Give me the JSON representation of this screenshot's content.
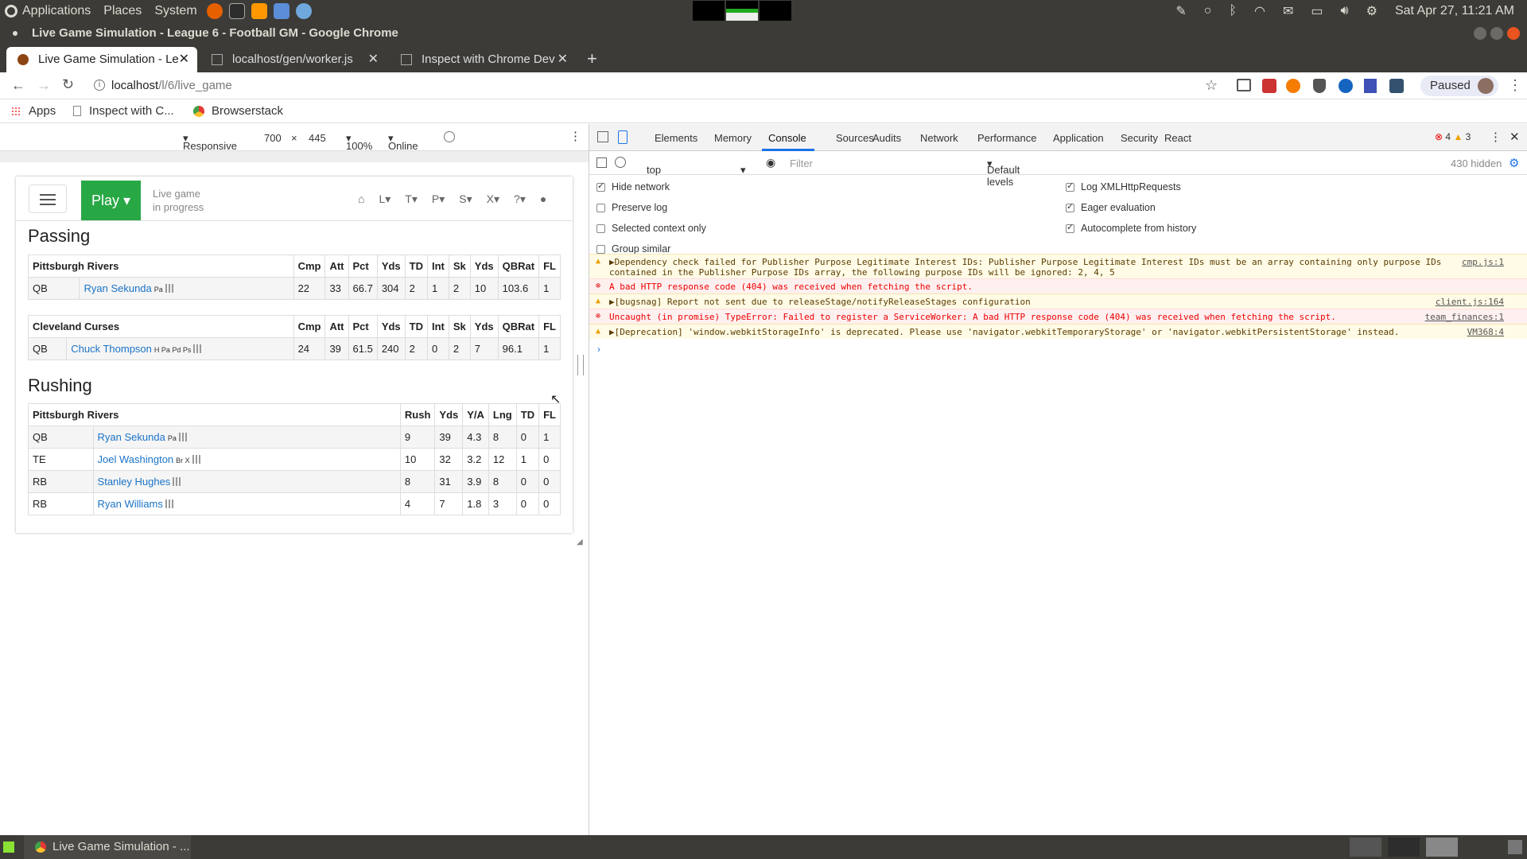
{
  "system_bar": {
    "menus": [
      "Applications",
      "Places",
      "System"
    ],
    "datetime": "Sat Apr 27, 11:21 AM"
  },
  "window": {
    "title": "Live Game Simulation - League 6 - Football GM - Google Chrome"
  },
  "tabs": [
    {
      "label": "Live Game Simulation - Le",
      "active": true
    },
    {
      "label": "localhost/gen/worker.js",
      "active": false
    },
    {
      "label": "Inspect with Chrome Dev",
      "active": false
    }
  ],
  "omnibox": {
    "host": "localhost",
    "path": "/l/6/live_game",
    "profile_status": "Paused"
  },
  "bookmarks": [
    "Apps",
    "Inspect with C...",
    "Browserstack"
  ],
  "device_toolbar": {
    "mode": "Responsive",
    "width": "700",
    "x": "×",
    "height": "445",
    "zoom": "100%",
    "network": "Online"
  },
  "page": {
    "play_button": "Play",
    "status_line1": "Live game",
    "status_line2": "in progress",
    "nav_letters": [
      "L",
      "T",
      "P",
      "S",
      "X",
      "?"
    ],
    "passing": {
      "title": "Passing",
      "tables": [
        {
          "team": "Pittsburgh Rivers",
          "cols": [
            "Cmp",
            "Att",
            "Pct",
            "Yds",
            "TD",
            "Int",
            "Sk",
            "Yds",
            "QBRat",
            "FL"
          ],
          "rows": [
            {
              "pos": "QB",
              "name": "Ryan Sekunda",
              "skills": "Pa",
              "vals": [
                "22",
                "33",
                "66.7",
                "304",
                "2",
                "1",
                "2",
                "10",
                "103.6",
                "1"
              ]
            }
          ]
        },
        {
          "team": "Cleveland Curses",
          "cols": [
            "Cmp",
            "Att",
            "Pct",
            "Yds",
            "TD",
            "Int",
            "Sk",
            "Yds",
            "QBRat",
            "FL"
          ],
          "rows": [
            {
              "pos": "QB",
              "name": "Chuck Thompson",
              "skills": "H Pa Pd Ps",
              "vals": [
                "24",
                "39",
                "61.5",
                "240",
                "2",
                "0",
                "2",
                "7",
                "96.1",
                "1"
              ]
            }
          ]
        }
      ]
    },
    "rushing": {
      "title": "Rushing",
      "team": "Pittsburgh Rivers",
      "cols": [
        "Rush",
        "Yds",
        "Y/A",
        "Lng",
        "TD",
        "FL"
      ],
      "rows": [
        {
          "pos": "QB",
          "name": "Ryan Sekunda",
          "skills": "Pa",
          "vals": [
            "9",
            "39",
            "4.3",
            "8",
            "0",
            "1"
          ]
        },
        {
          "pos": "TE",
          "name": "Joel Washington",
          "skills": "Br X",
          "vals": [
            "10",
            "32",
            "3.2",
            "12",
            "1",
            "0"
          ]
        },
        {
          "pos": "RB",
          "name": "Stanley Hughes",
          "skills": "",
          "vals": [
            "8",
            "31",
            "3.9",
            "8",
            "0",
            "0"
          ]
        },
        {
          "pos": "RB",
          "name": "Ryan Williams",
          "skills": "",
          "vals": [
            "4",
            "7",
            "1.8",
            "3",
            "0",
            "0"
          ]
        }
      ]
    }
  },
  "devtools": {
    "tabs": [
      "Elements",
      "Memory",
      "Console",
      "Sources",
      "Audits",
      "Network",
      "Performance",
      "Application",
      "Security",
      "React"
    ],
    "active_tab": "Console",
    "error_count": "4",
    "warning_count": "3",
    "context": "top",
    "filter_placeholder": "Filter",
    "levels": "Default levels",
    "hidden": "430 hidden",
    "options_left": [
      {
        "label": "Hide network",
        "checked": true
      },
      {
        "label": "Preserve log",
        "checked": false
      },
      {
        "label": "Selected context only",
        "checked": false
      },
      {
        "label": "Group similar",
        "checked": false
      }
    ],
    "options_right": [
      {
        "label": "Log XMLHttpRequests",
        "checked": true
      },
      {
        "label": "Eager evaluation",
        "checked": true
      },
      {
        "label": "Autocomplete from history",
        "checked": true
      }
    ],
    "messages": [
      {
        "level": "warn",
        "text": "▶Dependency check failed for Publisher Purpose Legitimate Interest IDs: Publisher Purpose Legitimate Interest IDs must be an array containing only purpose IDs",
        "text2": "contained in the Publisher Purpose IDs array, the following purpose IDs will be ignored: 2, 4, 5",
        "source": "cmp.js:1"
      },
      {
        "level": "err",
        "text": "A bad HTTP response code (404) was received when fetching the script.",
        "source": ""
      },
      {
        "level": "warn",
        "text": "▶[bugsnag] Report not sent due to releaseStage/notifyReleaseStages configuration",
        "source": "client.js:164"
      },
      {
        "level": "err",
        "text": "Uncaught (in promise) TypeError: Failed to register a ServiceWorker: A bad HTTP response code (404) was received when fetching the script.",
        "source": "team_finances:1"
      },
      {
        "level": "warn",
        "text": "▶[Deprecation] 'window.webkitStorageInfo' is deprecated. Please use 'navigator.webkitTemporaryStorage' or 'navigator.webkitPersistentStorage' instead.",
        "source": "VM368:4"
      }
    ]
  },
  "taskbar": {
    "item": "Live Game Simulation - ..."
  },
  "colors": {
    "play": "#28a745",
    "link": "#1a73c7",
    "error": "#e00000",
    "warning": "#f0a000",
    "chrome_dark": "#3c3b37"
  }
}
